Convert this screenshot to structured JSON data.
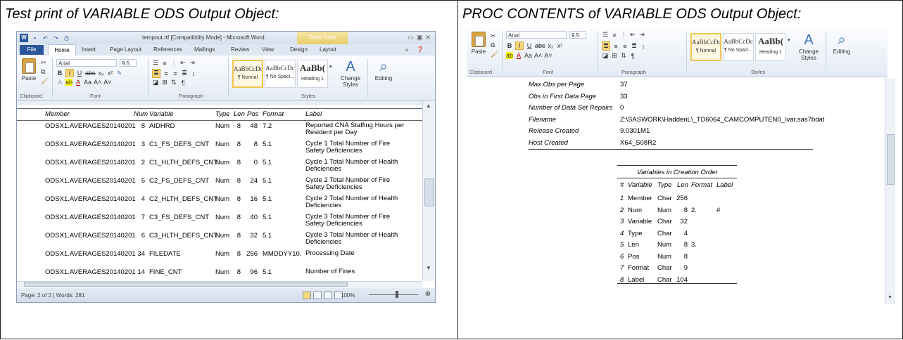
{
  "left_title": "Test print of VARIABLE ODS Output Object:",
  "right_title": "PROC CONTENTS of VARIABLE ODS Output Object:",
  "word": {
    "window_title": "tempout.rtf [Compatibility Mode] - Microsoft Word",
    "context_tab": "Table Tools",
    "tabs": [
      "File",
      "Home",
      "Insert",
      "Page Layout",
      "References",
      "Mailings",
      "Review",
      "View",
      "Design",
      "Layout"
    ],
    "font_name": "Arial",
    "font_size": "9.5",
    "paste_label": "Paste",
    "groups": {
      "clipboard": "Clipboard",
      "font": "Font",
      "paragraph": "Paragraph",
      "styles": "Styles",
      "editing": "Editing"
    },
    "styles": [
      {
        "sample": "AaBbCcDc",
        "name": "¶ Normal"
      },
      {
        "sample": "AaBbCcDc",
        "name": "¶ No Spaci..."
      },
      {
        "sample": "AaBb(",
        "name": "Heading 1"
      }
    ],
    "change_styles": "Change Styles",
    "editing": "Editing",
    "status": "Page: 2 of 2  |  Words: 281",
    "zoom": "100%"
  },
  "variables_table": {
    "headers": [
      "Member",
      "Num",
      "Variable",
      "Type",
      "Len",
      "Pos",
      "Format",
      "Label"
    ],
    "rows": [
      [
        "ODSX1.AVERAGES20140201",
        "8",
        "AIDHRD",
        "Num",
        "8",
        "48",
        "7.2",
        "Reported CNA Staffing Hours per Resident per Day"
      ],
      [
        "ODSX1.AVERAGES20140201",
        "3",
        "C1_FS_DEFS_CNT",
        "Num",
        "8",
        "8",
        "5.1",
        "Cycle 1 Total Number of Fire Safety Deficiencies"
      ],
      [
        "ODSX1.AVERAGES20140201",
        "2",
        "C1_HLTH_DEFS_CNT",
        "Num",
        "8",
        "0",
        "5.1",
        "Cycle 1 Total Number of Health Deficiencies"
      ],
      [
        "ODSX1.AVERAGES20140201",
        "5",
        "C2_FS_DEFS_CNT",
        "Num",
        "8",
        "24",
        "5.1",
        "Cycle 2 Total Number of Fire Safety Deficiencies"
      ],
      [
        "ODSX1.AVERAGES20140201",
        "4",
        "C2_HLTH_DEFS_CNT",
        "Num",
        "8",
        "16",
        "5.1",
        "Cycle 2 Total Number of Health Deficiencies"
      ],
      [
        "ODSX1.AVERAGES20140201",
        "7",
        "C3_FS_DEFS_CNT",
        "Num",
        "8",
        "40",
        "5.1",
        "Cycle 3 Total Number of Fire Safety Deficiencies"
      ],
      [
        "ODSX1.AVERAGES20140201",
        "6",
        "C3_HLTH_DEFS_CNT",
        "Num",
        "8",
        "32",
        "5.1",
        "Cycle 3 Total Number of Health Deficiencies"
      ],
      [
        "ODSX1.AVERAGES20140201",
        "34",
        "FILEDATE",
        "Num",
        "8",
        "256",
        "MMDDYY10.",
        "Processing Date"
      ],
      [
        "ODSX1.AVERAGES20140201",
        "14",
        "FINE_CNT",
        "Num",
        "8",
        "96",
        "5.1",
        "Number of Fines"
      ]
    ]
  },
  "attributes": [
    {
      "key": "Max Obs per Page",
      "value": "37"
    },
    {
      "key": "Obs in First Data Page",
      "value": "33"
    },
    {
      "key": "Number of Data Set Repairs",
      "value": "0"
    },
    {
      "key": "Filename",
      "value": "Z:\\SASWORK\\HaddenL\\_TD6064_CAMCOMPUTEN0_\\var.sas7bdat"
    },
    {
      "key": "Release Created",
      "value": "9.0301M1"
    },
    {
      "key": "Host Created",
      "value": "X64_S08R2"
    }
  ],
  "creation_order": {
    "title": "Variables in Creation Order",
    "headers": [
      "#",
      "Variable",
      "Type",
      "Len",
      "Format",
      "Label"
    ],
    "rows": [
      [
        "1",
        "Member",
        "Char",
        "256",
        "",
        ""
      ],
      [
        "2",
        "Num",
        "Num",
        "8",
        "2.",
        "#"
      ],
      [
        "3",
        "Variable",
        "Char",
        "32",
        "",
        ""
      ],
      [
        "4",
        "Type",
        "Char",
        "4",
        "",
        ""
      ],
      [
        "5",
        "Len",
        "Num",
        "8",
        "3.",
        ""
      ],
      [
        "6",
        "Pos",
        "Num",
        "8",
        "",
        ""
      ],
      [
        "7",
        "Format",
        "Char",
        "9",
        "",
        ""
      ],
      [
        "8",
        "Label",
        "Char",
        "104",
        "",
        ""
      ]
    ]
  }
}
